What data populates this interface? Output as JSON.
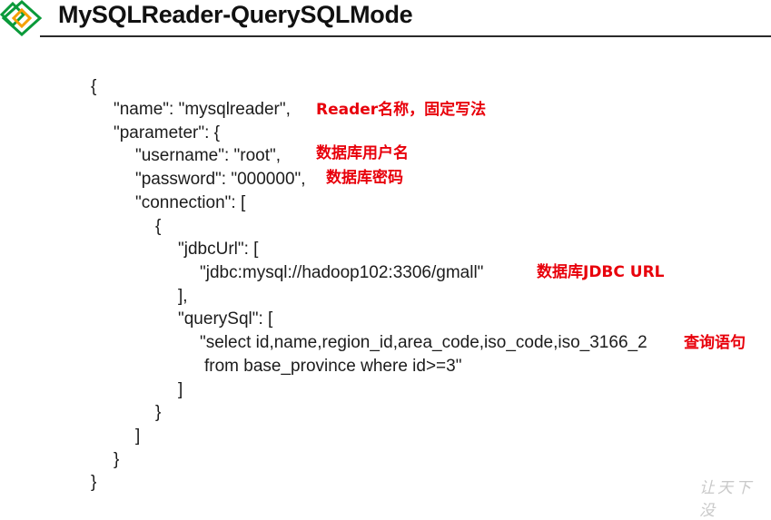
{
  "slide": {
    "title": "MySQLReader-QuerySQLMode",
    "logo_colors": {
      "outer": "#0a9a3a",
      "inner": "#f5a000"
    },
    "watermark": "让天下没"
  },
  "code_lines": [
    "{",
    "\"name\": \"mysqlreader\",",
    "\"parameter\": {",
    "\"username\": \"root\",",
    "\"password\": \"000000\",",
    "\"connection\": [",
    "{",
    "\"jdbcUrl\": [",
    "\"jdbc:mysql://hadoop102:3306/gmall\"",
    "],",
    "\"querySql\": [",
    "\"select id,name,region_id,area_code,iso_code,iso_3166_2",
    "from base_province where id>=3\"",
    "]",
    "}",
    "]",
    "}",
    "}"
  ],
  "annotations": {
    "name": "Reader名称，固定写法",
    "username": "数据库用户名",
    "password": "数据库密码",
    "jdbc": "数据库JDBC URL",
    "query": "查询语句"
  },
  "colors": {
    "annotation": "#e8000b",
    "code": "#1c1c1c"
  }
}
